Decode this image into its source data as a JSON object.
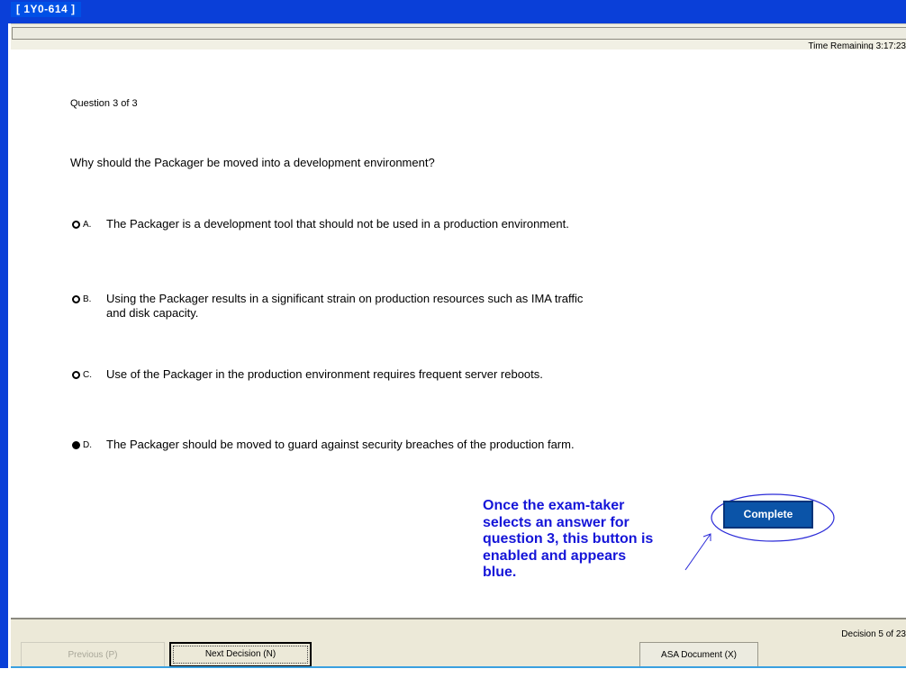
{
  "window": {
    "title": "[ 1Y0-614 ]"
  },
  "header": {
    "time_remaining": "Time Remaining 3:17:23"
  },
  "question": {
    "counter": "Question 3 of 3",
    "text": "Why should the Packager be moved into a development environment?",
    "options": [
      {
        "letter": "A.",
        "text": "The Packager is a development tool that should not be used in a production environment.",
        "selected": false
      },
      {
        "letter": "B.",
        "text": "Using the Packager results in a significant strain on production resources such as IMA traffic and disk capacity.",
        "selected": false
      },
      {
        "letter": "C.",
        "text": "Use of the Packager in the production environment requires frequent server reboots.",
        "selected": false
      },
      {
        "letter": "D.",
        "text": "The Packager should be moved to guard against security breaches of the production farm.",
        "selected": true
      }
    ]
  },
  "annotation": {
    "lines": [
      "Once the exam-taker",
      "selects an answer for",
      "question 3, this button is",
      "enabled and appears",
      "blue."
    ],
    "color": "#1515d8"
  },
  "complete_button": {
    "label": "Complete",
    "color": "#0b54a8"
  },
  "footer": {
    "decision_counter": "Decision 5 of 23",
    "previous_label": "Previous (P)",
    "next_label": "Next Decision (N)",
    "asa_label": "ASA Document (X)"
  }
}
